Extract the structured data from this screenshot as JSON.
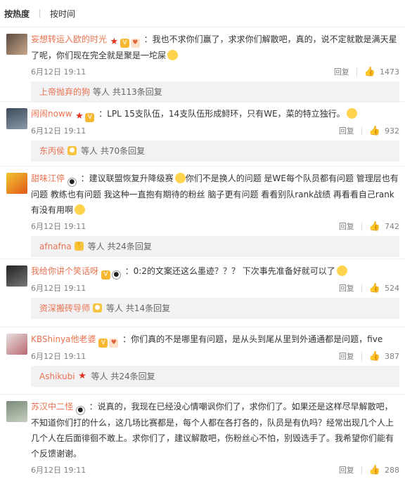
{
  "sort": {
    "hot": "按热度",
    "time": "按时间"
  },
  "comments": [
    {
      "username": "妄想转运入欧的时光",
      "text_pre": "：我也不求你们赢了，求求你们解散吧，真的，说不定就散是满天星了呢，你们现在完全就是聚是一坨屎",
      "date": "6月12日",
      "time": "19:11",
      "reply_label": "回复",
      "likes": "1473",
      "reply_user": "上帝抛弃的狗",
      "reply_summary": "等人 共113条回复"
    },
    {
      "username": "闹闹noww",
      "text_pre": "：LPL 15支队伍，14支队伍形成鲟环，只有WE，菜的特立独行。",
      "date": "6月12日",
      "time": "19:11",
      "reply_label": "回复",
      "likes": "932",
      "reply_user": "东丙侯",
      "reply_summary": "等人 共70条回复"
    },
    {
      "username": "甜味江停",
      "text_pre": "：建议联盟恢复升降级赛",
      "text_post": "你们不是换人的问题 是WE每个队员都有问题 管理层也有问题 教练也有问题 我这种一直抱有期待的粉丝 脑子更有问题  看看别队rank战绩 再看看自己rank有没有用啊",
      "date": "6月12日",
      "time": "19:11",
      "reply_label": "回复",
      "likes": "742",
      "reply_user": "afnafna",
      "reply_summary": "等人 共24条回复"
    },
    {
      "username": "我给你讲个笑话呀",
      "text_pre": "：0:2的文案还这么墨迹？？？ 下次事先准备好就可以了",
      "date": "6月12日",
      "time": "19:11",
      "reply_label": "回复",
      "likes": "524",
      "reply_user": "资深搬砖导师",
      "reply_summary": "等人 共14条回复"
    },
    {
      "username": "KBShinya他老婆",
      "text_pre": "：你们真的不是哪里有问题，是从头到尾从里到外通通都是问题，five",
      "date": "6月12日",
      "time": "19:11",
      "reply_label": "回复",
      "likes": "387",
      "reply_user": "Ashikubi",
      "reply_summary": "等人 共24条回复"
    },
    {
      "username": "苏汉中二怪",
      "text_pre": "：说真的，我现在已经没心情嘲讽你们了，求你们了。如果还是这样尽早解散吧，不知道你们打的什么，这几场比赛都是，每个人都在各打各的，队员是有仇吗？经常出现几个人上几个人在后面徘徊不敢上。求你们了，建议解散吧，伤粉丝心不怕，别毁选手了。我希望你们能有个反馈谢谢。",
      "date": "6月12日",
      "time": "19:11",
      "reply_label": "回复",
      "likes": "288"
    }
  ]
}
